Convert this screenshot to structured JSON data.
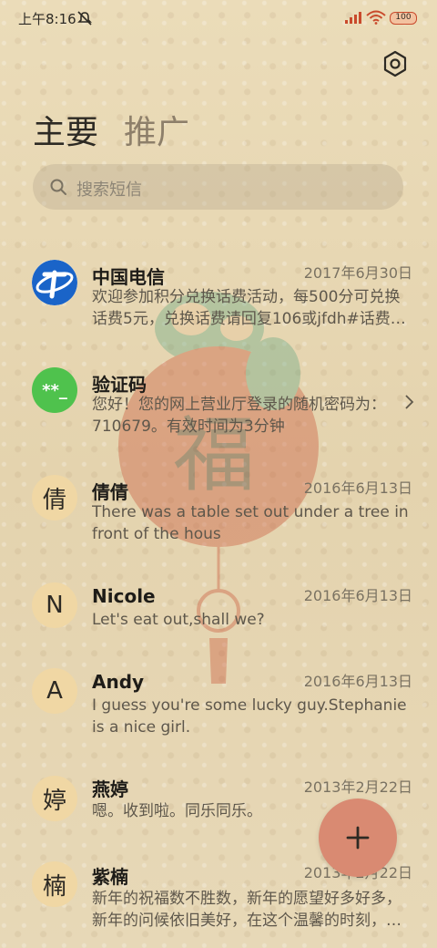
{
  "status_bar": {
    "time": "上午8:16",
    "battery": "100"
  },
  "tabs": [
    {
      "label": "主要"
    },
    {
      "label": "推广"
    }
  ],
  "search": {
    "placeholder": "搜索短信"
  },
  "conversations": [
    {
      "name": "中国电信",
      "date": "2017年6月30日",
      "snippet": "欢迎参加积分兑换话费活动，每500分可兑换话费5元，兑换话费请回复106或jfdh#话费…",
      "avatar": "telecom-logo"
    },
    {
      "name": "验证码",
      "date": "",
      "snippet": "您好！您的网上营业厅登录的随机密码为：710679。有效时间为3分钟",
      "avatar_text": "**_"
    },
    {
      "name": "倩倩",
      "date": "2016年6月13日",
      "snippet": "There was a table set out under a tree in front of the hous",
      "avatar_text": "倩"
    },
    {
      "name": "Nicole",
      "date": "2016年6月13日",
      "snippet": "Let's eat out,shall we?",
      "avatar_text": "N"
    },
    {
      "name": "Andy",
      "date": "2016年6月13日",
      "snippet": "I guess you're some lucky guy.Stephanie is a nice girl.",
      "avatar_text": "A"
    },
    {
      "name": "燕婷",
      "date": "2013年2月22日",
      "snippet": "嗯。收到啦。同乐同乐。",
      "avatar_text": "婷"
    },
    {
      "name": "紫楠",
      "date": "2013年2月22日",
      "snippet": "新年的祝福数不胜数，新年的愿望好多好多，新年的问候依旧美好，在这个温馨的时刻，…",
      "avatar_text": "楠"
    }
  ],
  "icons": {
    "settings": "hexagon-gear-icon",
    "search": "search-icon",
    "fab": "plus-icon",
    "chevron": "chevron-right-icon"
  },
  "colors": {
    "background": "#e7d8b6",
    "fab": "#d98a72",
    "avatar_default": "#f0d7a4",
    "avatar_green": "#4fc24d",
    "telecom_blue": "#1a64c8"
  }
}
